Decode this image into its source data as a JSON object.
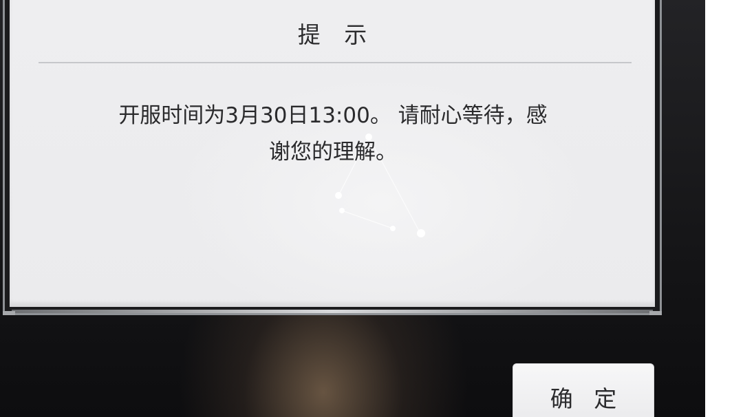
{
  "dialog": {
    "title": "提 示",
    "message_line1": "开服时间为3月30日13:00。 请耐心等待，感",
    "message_line2": "谢您的理解。"
  },
  "actions": {
    "confirm_label": "确 定"
  },
  "colors": {
    "dialog_background": "#ebebed",
    "frame": "#8f9296",
    "text": "#2a2a2c",
    "scene_background": "#141416",
    "warm_glow": "#76604a"
  },
  "icons": {
    "decoration": "constellation-decoration"
  }
}
